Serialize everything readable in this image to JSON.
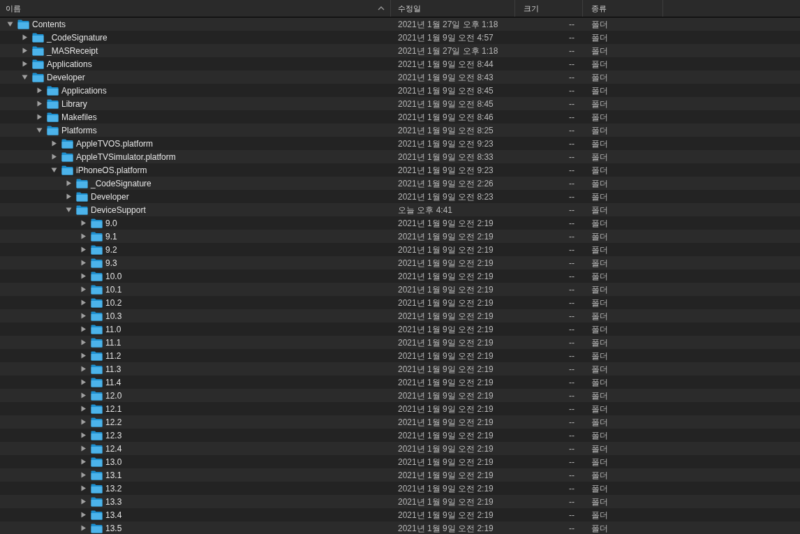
{
  "columns": [
    {
      "label": "이름",
      "sorted": true
    },
    {
      "label": "수정일",
      "sorted": false
    },
    {
      "label": "크기",
      "sorted": false
    },
    {
      "label": "종류",
      "sorted": false
    }
  ],
  "tree": [
    {
      "name": "Contents",
      "date": "2021년 1월 27일 오후 1:18",
      "size": "--",
      "kind": "폴더",
      "expanded": true,
      "children": [
        {
          "name": "_CodeSignature",
          "date": "2021년 1월 9일 오전 4:57",
          "size": "--",
          "kind": "폴더",
          "expanded": false
        },
        {
          "name": "_MASReceipt",
          "date": "2021년 1월 27일 오후 1:18",
          "size": "--",
          "kind": "폴더",
          "expanded": false
        },
        {
          "name": "Applications",
          "date": "2021년 1월 9일 오전 8:44",
          "size": "--",
          "kind": "폴더",
          "expanded": false
        },
        {
          "name": "Developer",
          "date": "2021년 1월 9일 오전 8:43",
          "size": "--",
          "kind": "폴더",
          "expanded": true,
          "children": [
            {
              "name": "Applications",
              "date": "2021년 1월 9일 오전 8:45",
              "size": "--",
              "kind": "폴더",
              "expanded": false
            },
            {
              "name": "Library",
              "date": "2021년 1월 9일 오전 8:45",
              "size": "--",
              "kind": "폴더",
              "expanded": false
            },
            {
              "name": "Makefiles",
              "date": "2021년 1월 9일 오전 8:46",
              "size": "--",
              "kind": "폴더",
              "expanded": false
            },
            {
              "name": "Platforms",
              "date": "2021년 1월 9일 오전 8:25",
              "size": "--",
              "kind": "폴더",
              "expanded": true,
              "children": [
                {
                  "name": "AppleTVOS.platform",
                  "date": "2021년 1월 9일 오전 9:23",
                  "size": "--",
                  "kind": "폴더",
                  "expanded": false
                },
                {
                  "name": "AppleTVSimulator.platform",
                  "date": "2021년 1월 9일 오전 8:33",
                  "size": "--",
                  "kind": "폴더",
                  "expanded": false
                },
                {
                  "name": "iPhoneOS.platform",
                  "date": "2021년 1월 9일 오전 9:23",
                  "size": "--",
                  "kind": "폴더",
                  "expanded": true,
                  "children": [
                    {
                      "name": "_CodeSignature",
                      "date": "2021년 1월 9일 오전 2:26",
                      "size": "--",
                      "kind": "폴더",
                      "expanded": false
                    },
                    {
                      "name": "Developer",
                      "date": "2021년 1월 9일 오전 8:23",
                      "size": "--",
                      "kind": "폴더",
                      "expanded": false
                    },
                    {
                      "name": "DeviceSupport",
                      "date": "오늘 오후 4:41",
                      "size": "--",
                      "kind": "폴더",
                      "expanded": true,
                      "children": [
                        {
                          "name": "9.0",
                          "date": "2021년 1월 9일 오전 2:19",
                          "size": "--",
                          "kind": "폴더",
                          "expanded": false
                        },
                        {
                          "name": "9.1",
                          "date": "2021년 1월 9일 오전 2:19",
                          "size": "--",
                          "kind": "폴더",
                          "expanded": false
                        },
                        {
                          "name": "9.2",
                          "date": "2021년 1월 9일 오전 2:19",
                          "size": "--",
                          "kind": "폴더",
                          "expanded": false
                        },
                        {
                          "name": "9.3",
                          "date": "2021년 1월 9일 오전 2:19",
                          "size": "--",
                          "kind": "폴더",
                          "expanded": false
                        },
                        {
                          "name": "10.0",
                          "date": "2021년 1월 9일 오전 2:19",
                          "size": "--",
                          "kind": "폴더",
                          "expanded": false
                        },
                        {
                          "name": "10.1",
                          "date": "2021년 1월 9일 오전 2:19",
                          "size": "--",
                          "kind": "폴더",
                          "expanded": false
                        },
                        {
                          "name": "10.2",
                          "date": "2021년 1월 9일 오전 2:19",
                          "size": "--",
                          "kind": "폴더",
                          "expanded": false
                        },
                        {
                          "name": "10.3",
                          "date": "2021년 1월 9일 오전 2:19",
                          "size": "--",
                          "kind": "폴더",
                          "expanded": false
                        },
                        {
                          "name": "11.0",
                          "date": "2021년 1월 9일 오전 2:19",
                          "size": "--",
                          "kind": "폴더",
                          "expanded": false
                        },
                        {
                          "name": "11.1",
                          "date": "2021년 1월 9일 오전 2:19",
                          "size": "--",
                          "kind": "폴더",
                          "expanded": false
                        },
                        {
                          "name": "11.2",
                          "date": "2021년 1월 9일 오전 2:19",
                          "size": "--",
                          "kind": "폴더",
                          "expanded": false
                        },
                        {
                          "name": "11.3",
                          "date": "2021년 1월 9일 오전 2:19",
                          "size": "--",
                          "kind": "폴더",
                          "expanded": false
                        },
                        {
                          "name": "11.4",
                          "date": "2021년 1월 9일 오전 2:19",
                          "size": "--",
                          "kind": "폴더",
                          "expanded": false
                        },
                        {
                          "name": "12.0",
                          "date": "2021년 1월 9일 오전 2:19",
                          "size": "--",
                          "kind": "폴더",
                          "expanded": false
                        },
                        {
                          "name": "12.1",
                          "date": "2021년 1월 9일 오전 2:19",
                          "size": "--",
                          "kind": "폴더",
                          "expanded": false
                        },
                        {
                          "name": "12.2",
                          "date": "2021년 1월 9일 오전 2:19",
                          "size": "--",
                          "kind": "폴더",
                          "expanded": false
                        },
                        {
                          "name": "12.3",
                          "date": "2021년 1월 9일 오전 2:19",
                          "size": "--",
                          "kind": "폴더",
                          "expanded": false
                        },
                        {
                          "name": "12.4",
                          "date": "2021년 1월 9일 오전 2:19",
                          "size": "--",
                          "kind": "폴더",
                          "expanded": false
                        },
                        {
                          "name": "13.0",
                          "date": "2021년 1월 9일 오전 2:19",
                          "size": "--",
                          "kind": "폴더",
                          "expanded": false
                        },
                        {
                          "name": "13.1",
                          "date": "2021년 1월 9일 오전 2:19",
                          "size": "--",
                          "kind": "폴더",
                          "expanded": false
                        },
                        {
                          "name": "13.2",
                          "date": "2021년 1월 9일 오전 2:19",
                          "size": "--",
                          "kind": "폴더",
                          "expanded": false
                        },
                        {
                          "name": "13.3",
                          "date": "2021년 1월 9일 오전 2:19",
                          "size": "--",
                          "kind": "폴더",
                          "expanded": false
                        },
                        {
                          "name": "13.4",
                          "date": "2021년 1월 9일 오전 2:19",
                          "size": "--",
                          "kind": "폴더",
                          "expanded": false
                        },
                        {
                          "name": "13.5",
                          "date": "2021년 1월 9일 오전 2:19",
                          "size": "--",
                          "kind": "폴더",
                          "expanded": false
                        }
                      ]
                    }
                  ]
                }
              ]
            }
          ]
        }
      ]
    }
  ]
}
